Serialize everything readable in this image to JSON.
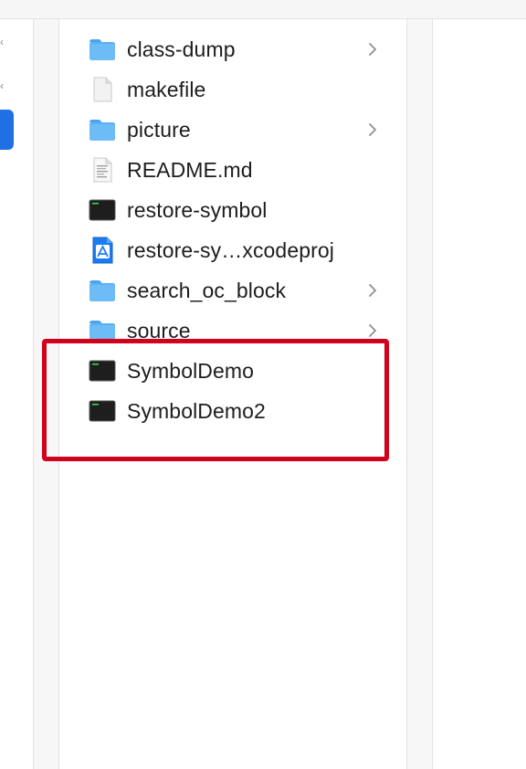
{
  "files": [
    {
      "name": "class-dump",
      "icon": "folder-icon",
      "has_children": true
    },
    {
      "name": "makefile",
      "icon": "document-icon",
      "has_children": false
    },
    {
      "name": "picture",
      "icon": "folder-icon",
      "has_children": true
    },
    {
      "name": "README.md",
      "icon": "text-document-icon",
      "has_children": false
    },
    {
      "name": "restore-symbol",
      "icon": "terminal-executable-icon",
      "has_children": false
    },
    {
      "name": "restore-sy…xcodeproj",
      "icon": "xcode-project-icon",
      "has_children": false
    },
    {
      "name": "search_oc_block",
      "icon": "folder-icon",
      "has_children": true
    },
    {
      "name": "source",
      "icon": "folder-icon",
      "has_children": true
    },
    {
      "name": "SymbolDemo",
      "icon": "terminal-executable-icon",
      "has_children": false
    },
    {
      "name": "SymbolDemo2",
      "icon": "terminal-executable-icon",
      "has_children": false
    }
  ],
  "colors": {
    "folder": "#5ab0f3",
    "highlight": "#d0021b",
    "selection": "#1f6fe5"
  }
}
